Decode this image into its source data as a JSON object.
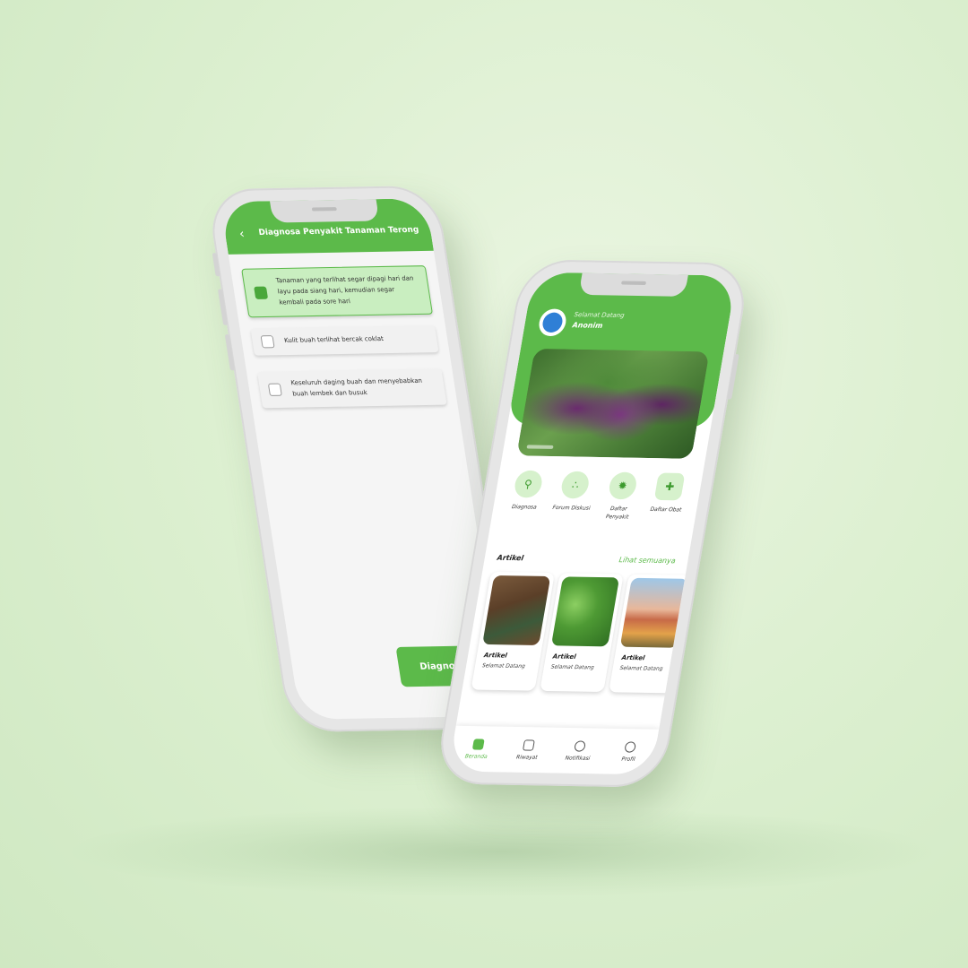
{
  "colors": {
    "accent": "#5cba4a",
    "accent_light": "#d6f1cc",
    "background": "#ddf0d1"
  },
  "diagnosis_screen": {
    "title": "Diagnosa Penyakit Tanaman Terong",
    "options": [
      {
        "text": "Tanaman yang terlihat segar dipagi hari dan layu pada siang hari, kemudian segar kembali pada sore hari",
        "checked": true
      },
      {
        "text": "Kulit buah terlihat bercak coklat",
        "checked": false
      },
      {
        "text": "Keseluruh daging buah dan menyebabkan buah lembek dan busuk",
        "checked": false
      }
    ],
    "submit_label": "Diagnosa"
  },
  "home_screen": {
    "greeting": "Selamat Datang",
    "username": "Anonim",
    "features": [
      {
        "label": "Diagnosa",
        "icon": "search-icon"
      },
      {
        "label": "Forum Diskusi",
        "icon": "forum-icon"
      },
      {
        "label": "Daftar Penyakit",
        "icon": "virus-icon"
      },
      {
        "label": "Daftar Obat",
        "icon": "medicine-icon"
      }
    ],
    "articles_section": {
      "title": "Artikel",
      "see_all": "Lihat semuanya",
      "items": [
        {
          "title": "Artikel",
          "subtitle": "Selamat Datang"
        },
        {
          "title": "Artikel",
          "subtitle": "Selamat Datang"
        },
        {
          "title": "Artikel",
          "subtitle": "Selamat Datang"
        }
      ]
    },
    "bottom_nav": [
      {
        "label": "Beranda",
        "icon": "home-icon",
        "active": true
      },
      {
        "label": "Riwayat",
        "icon": "history-icon",
        "active": false
      },
      {
        "label": "Notifikasi",
        "icon": "bell-icon",
        "active": false
      },
      {
        "label": "Profil",
        "icon": "user-icon",
        "active": false
      }
    ]
  }
}
